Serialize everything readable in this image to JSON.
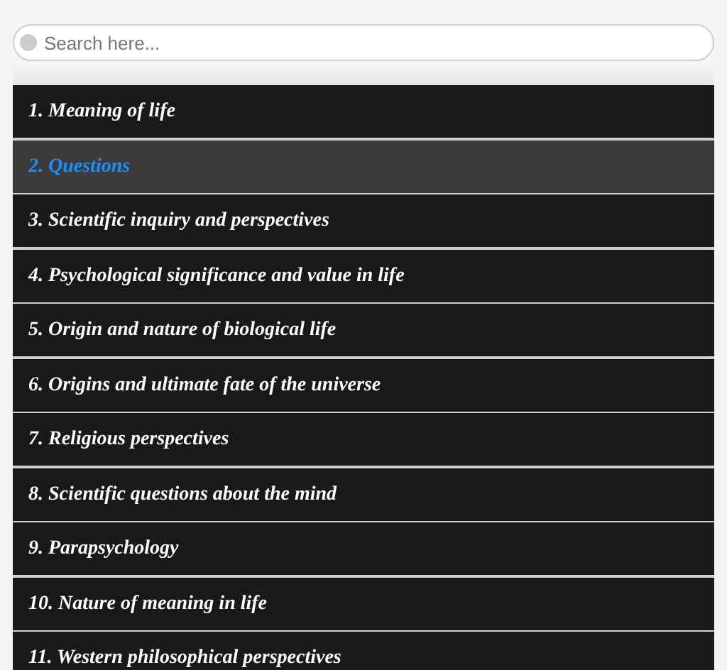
{
  "search": {
    "placeholder": "Search here..."
  },
  "items": [
    {
      "label": "1. Meaning of life",
      "selected": false
    },
    {
      "label": "2. Questions",
      "selected": true
    },
    {
      "label": "3. Scientific inquiry and perspectives",
      "selected": false
    },
    {
      "label": "4. Psychological significance and value in life",
      "selected": false
    },
    {
      "label": "5. Origin and nature of biological life",
      "selected": false
    },
    {
      "label": "6. Origins and ultimate fate of the universe",
      "selected": false
    },
    {
      "label": "7. Religious perspectives",
      "selected": false
    },
    {
      "label": "8. Scientific questions about the mind",
      "selected": false
    },
    {
      "label": "9. Parapsychology",
      "selected": false
    },
    {
      "label": "10. Nature of meaning in life",
      "selected": false
    },
    {
      "label": "11. Western philosophical perspectives",
      "selected": false
    }
  ]
}
